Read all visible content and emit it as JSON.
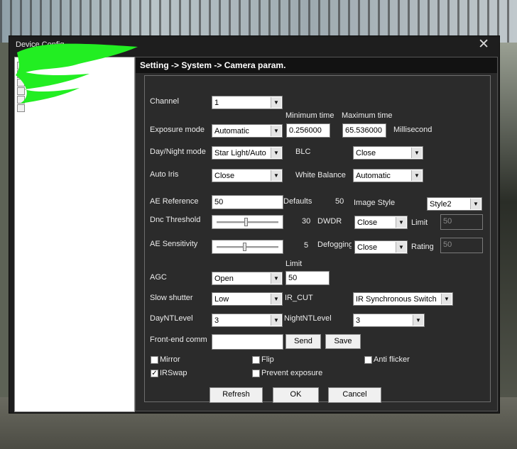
{
  "window": {
    "title": "Device Config",
    "close_symbol": "✕"
  },
  "header": {
    "breadcrumb": "Setting -> System -> Camera param."
  },
  "labels": {
    "min_time": "Minimum time",
    "max_time": "Maximum time",
    "millisecond": "Millisecond",
    "channel": "Channel",
    "exposure_mode": "Exposure mode",
    "day_night_mode": "Day/Night mode",
    "blc": "BLC",
    "auto_iris": "Auto Iris",
    "white_balance": "White Balance",
    "ae_reference": "AE Reference",
    "defaults": "Defaults",
    "image_style": "Image Style",
    "dnc_threshold": "Dnc Threshold",
    "dwdr": "DWDR",
    "dwdr_limit": "Limit",
    "ae_sensitivity": "AE Sensitivity",
    "defogging": "Defogging",
    "rating": "Rating",
    "agc_limit": "Limit",
    "agc": "AGC",
    "slow_shutter": "Slow shutter",
    "ir_cut": "IR_CUT",
    "day_nt_level": "DayNTLevel",
    "night_nt_level": "NightNTLevel",
    "front_end_comm": "Front-end comm"
  },
  "fields": {
    "channel": "1",
    "exposure_mode": "Automatic",
    "min_time": "0.256000",
    "max_time": "65.536000",
    "day_night_mode": "Star Light/Auto",
    "blc": "Close",
    "auto_iris": "Close",
    "white_balance": "Automatic",
    "ae_reference": "50",
    "defaults_value": "50",
    "image_style": "Style2",
    "dnc_threshold_value": "30",
    "dwdr": "Close",
    "dwdr_limit": "50",
    "ae_sensitivity_value": "5",
    "defogging": "Close",
    "rating": "50",
    "agc": "Open",
    "agc_limit": "50",
    "slow_shutter": "Low",
    "ir_cut": "IR Synchronous Switch",
    "day_nt_level": "3",
    "night_nt_level": "3",
    "front_end_comm": ""
  },
  "sliders": {
    "dnc_threshold_fraction": 0.48,
    "ae_sensitivity_fraction": 0.45
  },
  "buttons": {
    "send": "Send",
    "save": "Save",
    "refresh": "Refresh",
    "ok": "OK",
    "cancel": "Cancel"
  },
  "checkboxes": {
    "mirror": {
      "label": "Mirror",
      "checked": false
    },
    "flip": {
      "label": "Flip",
      "checked": false
    },
    "anti_flicker": {
      "label": "Anti flicker",
      "checked": false
    },
    "irswap": {
      "label": "IRSwap",
      "checked": true
    },
    "prevent_exposure": {
      "label": "Prevent exposure",
      "checked": false
    }
  },
  "icons": {
    "dropdown": "chevron-down-icon",
    "close": "close-icon",
    "check": "check-icon"
  },
  "colors": {
    "window_bg": "#1e1e1e",
    "panel_bg": "#2b2b2b",
    "header_bg": "#121212",
    "redaction": "#22ee22"
  }
}
